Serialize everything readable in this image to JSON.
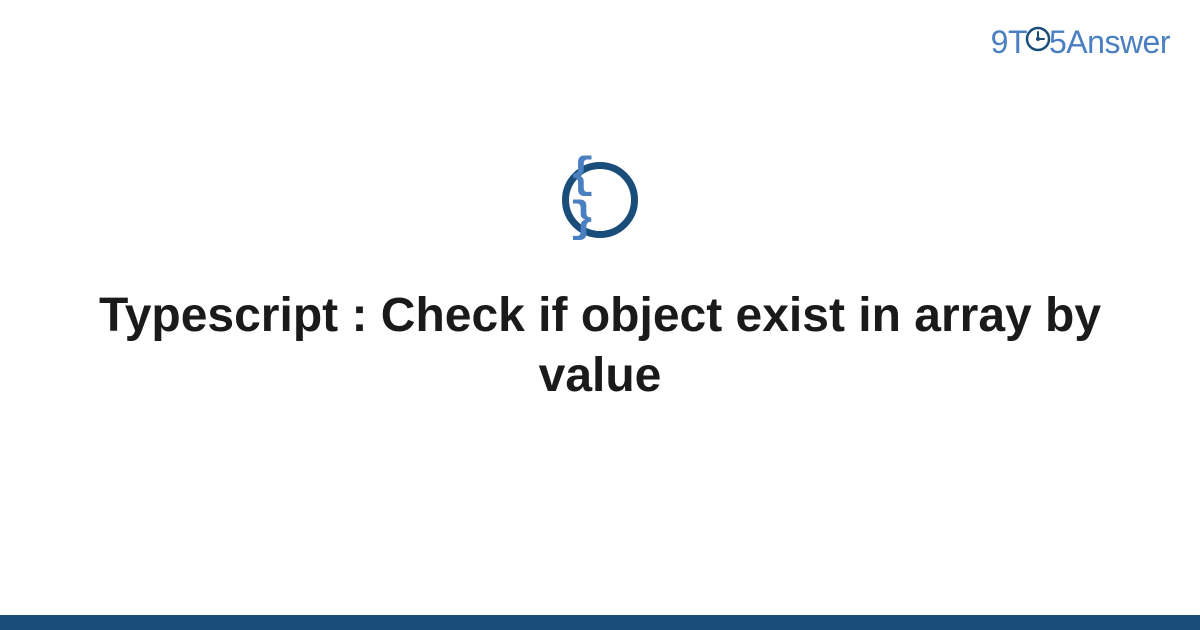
{
  "brand": {
    "nine": "9",
    "t": "T",
    "five": "5",
    "answer": "Answer"
  },
  "icon": {
    "braces": "{ }"
  },
  "title": "Typescript : Check if object exist in array by value",
  "colors": {
    "brand": "#4a7fc1",
    "darkBlue": "#1a4d7a"
  }
}
